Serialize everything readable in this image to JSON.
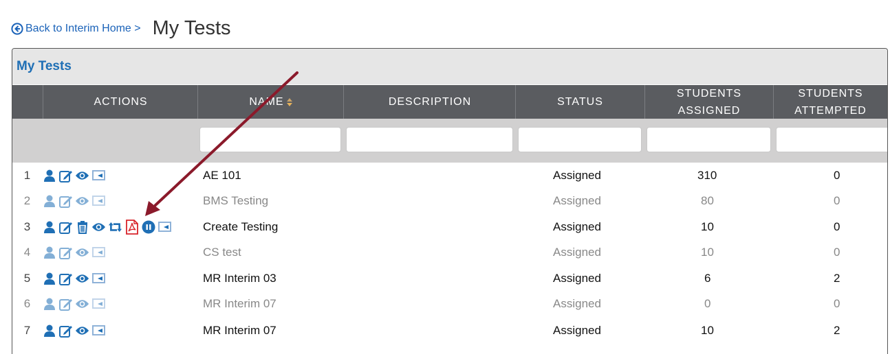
{
  "nav": {
    "back_label": "Back to Interim Home >",
    "page_title": "My Tests"
  },
  "panel": {
    "title": "My Tests"
  },
  "columns": {
    "actions": "ACTIONS",
    "name": "NAME",
    "description": "DESCRIPTION",
    "status": "STATUS",
    "students_assigned_1": "STUDENTS",
    "students_assigned_2": "ASSIGNED",
    "students_attempted_1": "STUDENTS",
    "students_attempted_2": "ATTEMPTED"
  },
  "rows": [
    {
      "num": "1",
      "name": "AE 101",
      "status": "Assigned",
      "assigned": "310",
      "attempted": "0"
    },
    {
      "num": "2",
      "name": "BMS Testing",
      "status": "Assigned",
      "assigned": "80",
      "attempted": "0"
    },
    {
      "num": "3",
      "name": "Create Testing",
      "status": "Assigned",
      "assigned": "10",
      "attempted": "0"
    },
    {
      "num": "4",
      "name": "CS test",
      "status": "Assigned",
      "assigned": "10",
      "attempted": "0"
    },
    {
      "num": "5",
      "name": "MR Interim 03",
      "status": "Assigned",
      "assigned": "6",
      "attempted": "2"
    },
    {
      "num": "6",
      "name": "MR Interim 07",
      "status": "Assigned",
      "assigned": "0",
      "attempted": "0"
    },
    {
      "num": "7",
      "name": "MR Interim 07",
      "status": "Assigned",
      "assigned": "10",
      "attempted": "2"
    }
  ],
  "colors": {
    "link": "#1a62b8",
    "header_bg": "#5a5c60",
    "icon_blue": "#1f6fb5",
    "pdf_red": "#d8232a",
    "arrow": "#8b1a2b"
  }
}
